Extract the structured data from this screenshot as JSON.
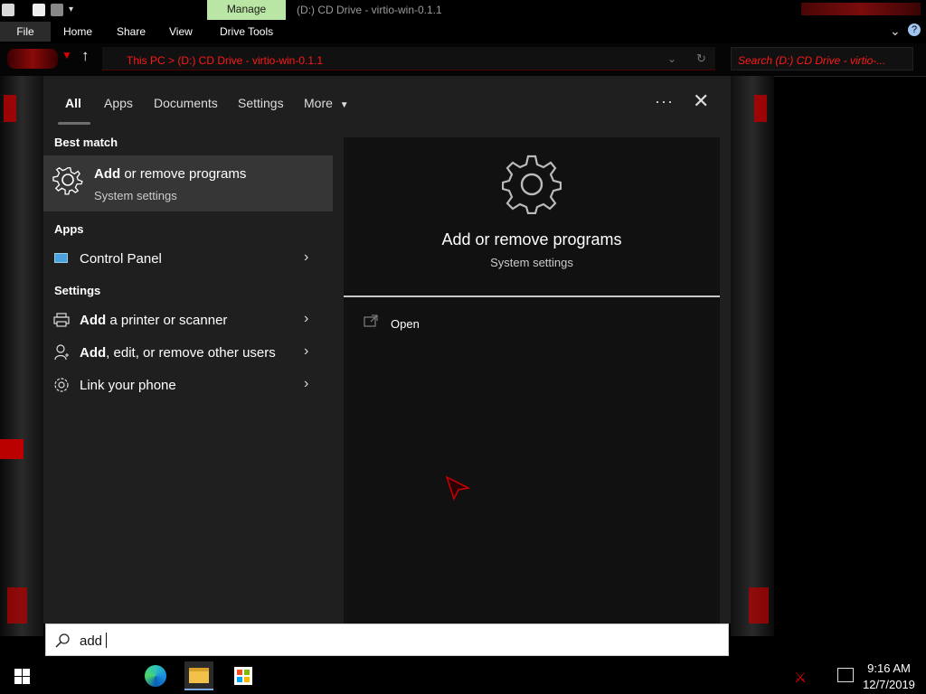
{
  "titlebar": {
    "manage_label": "Manage",
    "window_title": "(D:) CD Drive - virtio-win-0.1.1"
  },
  "ribbon": {
    "tabs": [
      "File",
      "Home",
      "Share",
      "View",
      "Drive Tools"
    ]
  },
  "address_bar": {
    "path": "This PC  >  (D:) CD Drive - virtio-win-0.1.1",
    "search_placeholder": "Search (D:) CD Drive - virtio-..."
  },
  "search_menu": {
    "tabs": [
      "All",
      "Apps",
      "Documents",
      "Settings",
      "More"
    ],
    "best_match_heading": "Best match",
    "best_match": {
      "title_bold": "Add",
      "title_rest": " or remove programs",
      "subtitle": "System settings"
    },
    "apps_heading": "Apps",
    "apps": [
      {
        "label": "Control Panel"
      }
    ],
    "settings_heading": "Settings",
    "settings": [
      {
        "bold": "Add",
        "rest": " a printer or scanner"
      },
      {
        "bold": "Add",
        "rest": ", edit, or remove other users"
      },
      {
        "bold": "",
        "rest": "Link your phone"
      }
    ],
    "preview": {
      "title": "Add or remove programs",
      "subtitle": "System settings",
      "open_label": "Open"
    },
    "search_value": "add"
  },
  "taskbar": {
    "time": "9:16 AM",
    "date": "12/7/2019"
  },
  "colors": {
    "accent_red": "#ff1818",
    "manage_green": "#b9e6a4",
    "menu_bg": "#1f1f1f",
    "preview_bg": "#111111"
  }
}
